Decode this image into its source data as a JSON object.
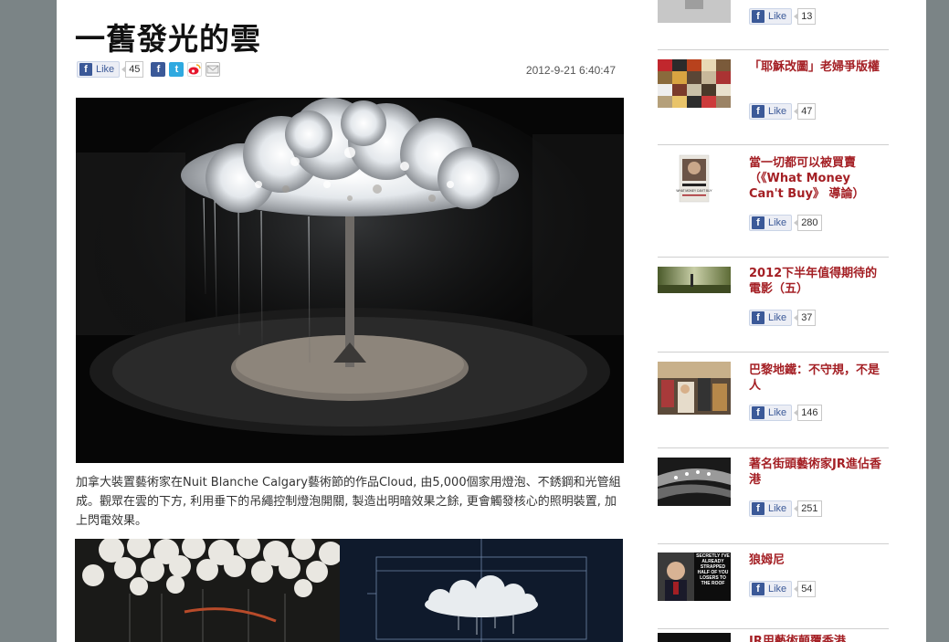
{
  "article": {
    "title": "一舊發光的雲",
    "date": "2012-9-21 6:40:47",
    "fb_like_label": "Like",
    "fb_like_count": "45",
    "description": "加拿大裝置藝術家在Nuit Blanche Calgary藝術節的作品Cloud, 由5,000個家用燈泡、不銹鋼和光管組成。觀眾在雲的下方, 利用垂下的吊繩控制燈泡開關, 製造出明暗效果之餘, 更會觸發核心的照明裝置, 加上閃電效果。"
  },
  "sidebar": {
    "like_label": "Like",
    "top_like_count": "13",
    "items": [
      {
        "title": "「耶穌改圖」老婦爭版權",
        "likes": "47"
      },
      {
        "title": "當一切都可以被買賣（《What Money Can't Buy》 導論）",
        "likes": "280"
      },
      {
        "title": "2012下半年值得期待的電影（五）",
        "likes": "37"
      },
      {
        "title": "巴黎地鐵：不守規，不是人",
        "likes": "146"
      },
      {
        "title": "著名街頭藝術家JR進佔香港",
        "likes": "251"
      },
      {
        "title": "狼姆尼",
        "likes": "54"
      },
      {
        "title": "JR用藝術顛覆香港",
        "likes": ""
      }
    ]
  },
  "book_cover": {
    "text": "WHAT MONEY CAN'T BUY"
  },
  "romney_thumb": {
    "text": "SECRETLY I'VE ALREADY STRAPPED HALF OF YOU LOSERS TO THE ROOF"
  },
  "icons": {
    "facebook": "facebook-icon",
    "twitter": "twitter-icon",
    "weibo": "weibo-icon",
    "email": "email-icon"
  },
  "colors": {
    "background": "#7b8486",
    "link": "#a41f24",
    "facebook": "#3b5998"
  }
}
